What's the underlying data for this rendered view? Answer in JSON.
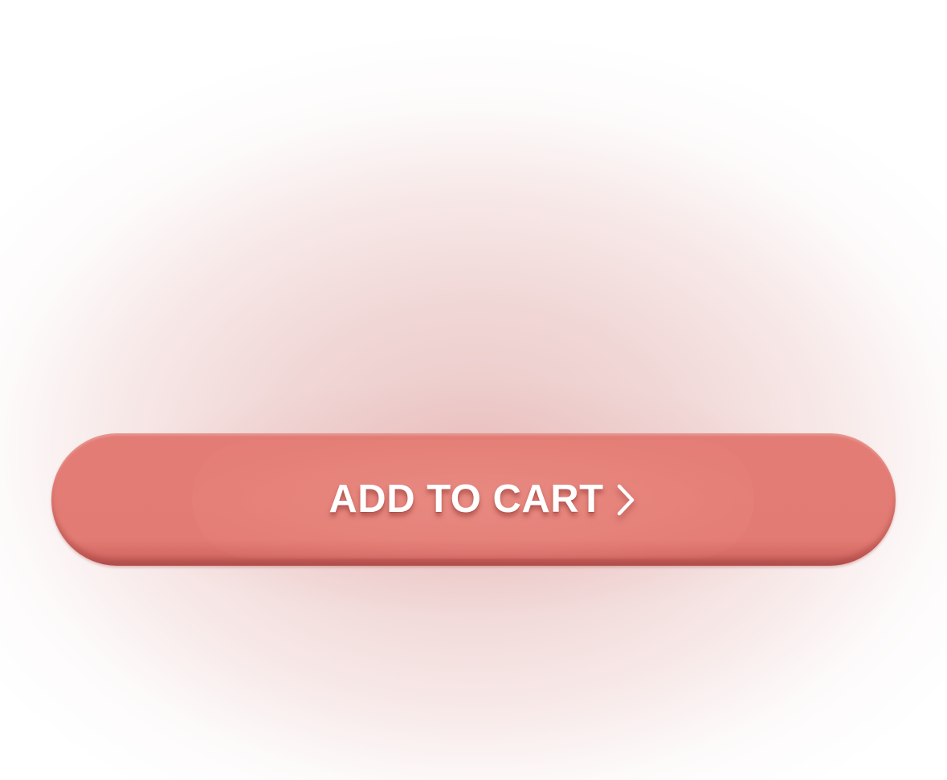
{
  "button": {
    "label": "ADD TO CART",
    "icon": "chevron-right-icon",
    "color": "#e37c74",
    "text_color": "#ffffff"
  },
  "background": {
    "glow_color": "#ebc7c6",
    "base_color": "#ffffff"
  }
}
